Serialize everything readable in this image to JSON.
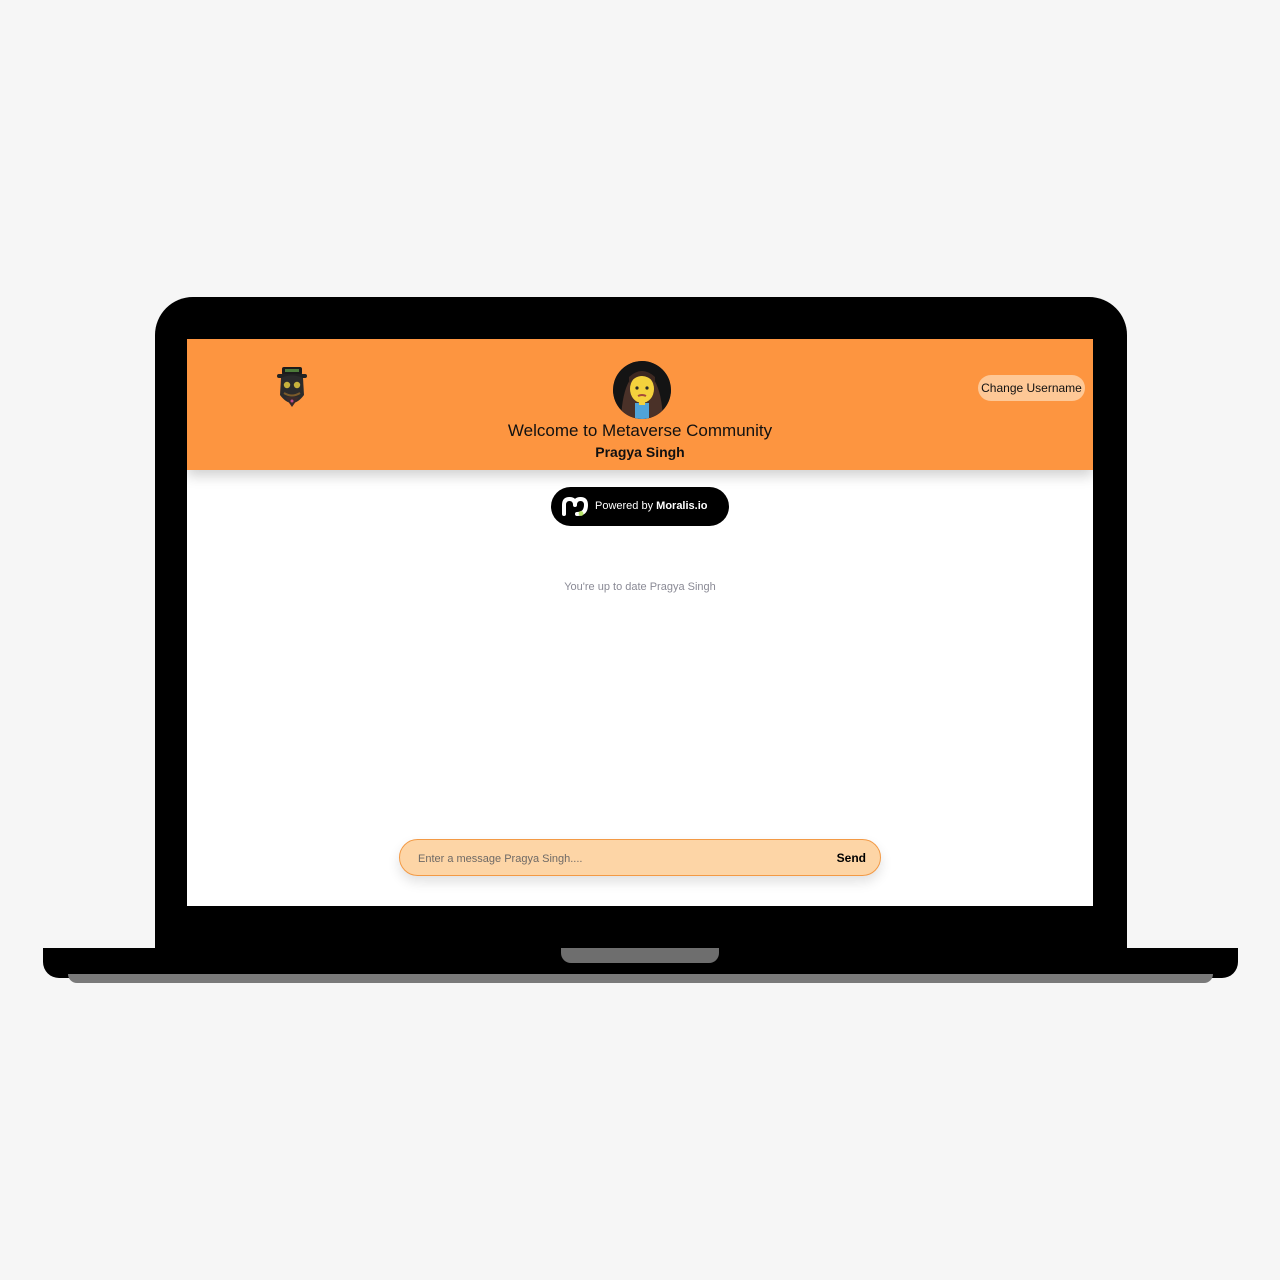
{
  "header": {
    "welcome_title": "Welcome to Metaverse Community",
    "username": "Pragya Singh",
    "change_username_label": "Change Username",
    "background_color": "#fd9540",
    "brand_logo_icon": "hacker-mask-logo-icon",
    "avatar_icon": "user-avatar-icon"
  },
  "badge": {
    "prefix": "Powered by",
    "brand": "Moralis.io",
    "icon": "moralis-logo-icon"
  },
  "messages": {
    "status_text": "You're up to date Pragya Singh"
  },
  "composer": {
    "placeholder": "Enter a message Pragya Singh....",
    "value": "",
    "send_label": "Send",
    "background_color": "#fdd5a6"
  }
}
